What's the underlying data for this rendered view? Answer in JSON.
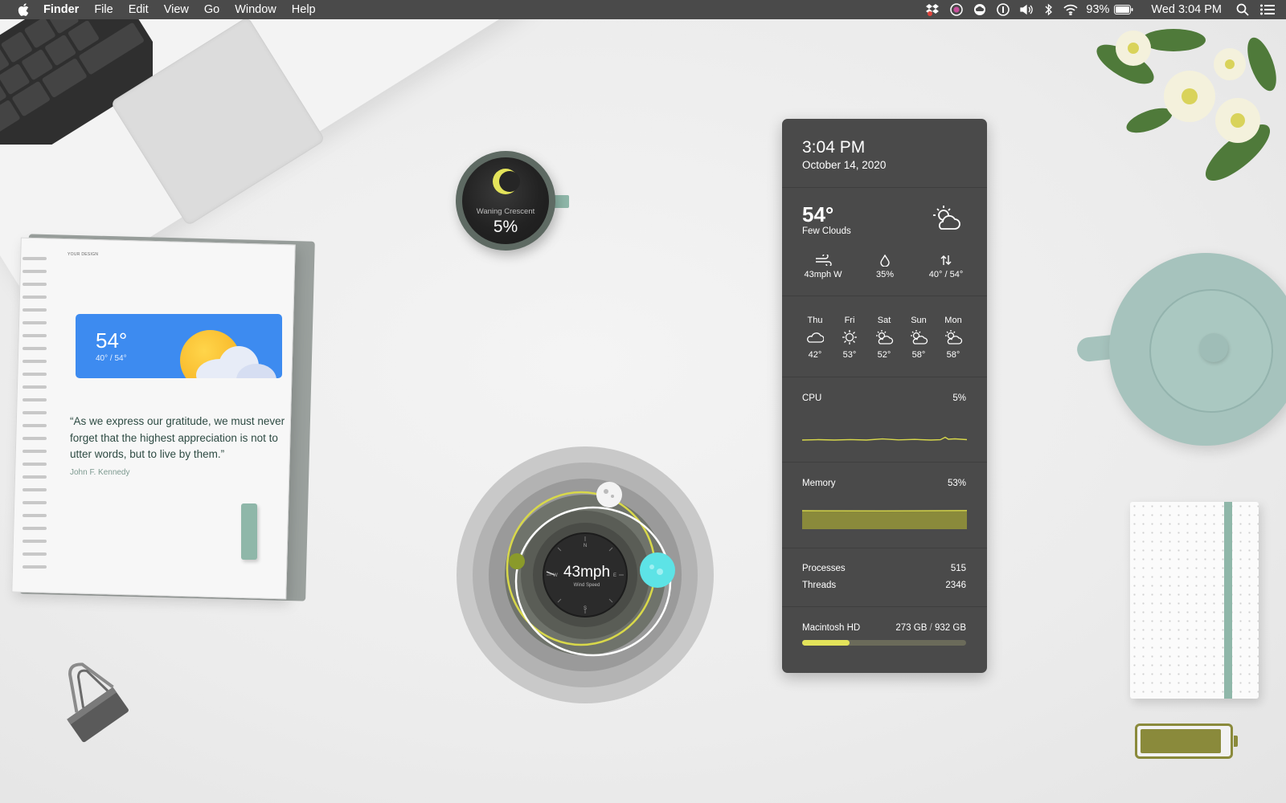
{
  "menubar": {
    "app_name": "Finder",
    "menus": [
      "File",
      "Edit",
      "View",
      "Go",
      "Window",
      "Help"
    ],
    "battery_percent": "93%",
    "clock": "Wed 3:04 PM",
    "status_icons": [
      "dropbox-icon",
      "screen-record-icon",
      "creative-cloud-icon",
      "1password-icon",
      "volume-icon",
      "bluetooth-icon",
      "wifi-icon",
      "battery-icon",
      "spotlight-icon",
      "control-center-icon"
    ]
  },
  "notebook": {
    "header_text": "YOUR DESIGN",
    "weather_card": {
      "temp": "54°",
      "range": "40° / 54°"
    },
    "quote": "“As we express our gratitude, we must never forget that the highest appreciation is not to utter words, but to live by them.”",
    "author": "John F. Kennedy"
  },
  "moon": {
    "phase": "Waning Crescent",
    "illumination": "5%"
  },
  "wind": {
    "speed": "43mph",
    "label": "Wind Speed",
    "compass": [
      "N",
      "E",
      "S",
      "W"
    ]
  },
  "panel": {
    "time": "3:04 PM",
    "date": "October 14, 2020",
    "weather": {
      "temp": "54°",
      "condition": "Few Clouds",
      "icon": "partly-cloudy-icon",
      "wind": "43mph W",
      "humidity": "35%",
      "range": "40° / 54°"
    },
    "forecast": [
      {
        "day": "Thu",
        "temp": "42°",
        "icon": "cloud-icon"
      },
      {
        "day": "Fri",
        "temp": "53°",
        "icon": "sun-icon"
      },
      {
        "day": "Sat",
        "temp": "52°",
        "icon": "partly-cloudy-icon"
      },
      {
        "day": "Sun",
        "temp": "58°",
        "icon": "partly-cloudy-icon"
      },
      {
        "day": "Mon",
        "temp": "58°",
        "icon": "partly-cloudy-icon"
      }
    ],
    "cpu": {
      "label": "CPU",
      "value": "5%"
    },
    "memory": {
      "label": "Memory",
      "value": "53%"
    },
    "processes": {
      "label": "Processes",
      "value": "515"
    },
    "threads": {
      "label": "Threads",
      "value": "2346"
    },
    "disk": {
      "label": "Macintosh HD",
      "used": "273 GB",
      "separator": "/",
      "total": "932 GB",
      "used_fraction": 0.29
    }
  },
  "desk_battery": {
    "level_fraction": 0.93
  },
  "colors": {
    "accent_yellow": "#d8d84a",
    "accent_cyan": "#5de3e6",
    "olive": "#8a8a3b",
    "panel_bg": "#4a4a4a",
    "card_blue": "#3d8bf0"
  }
}
